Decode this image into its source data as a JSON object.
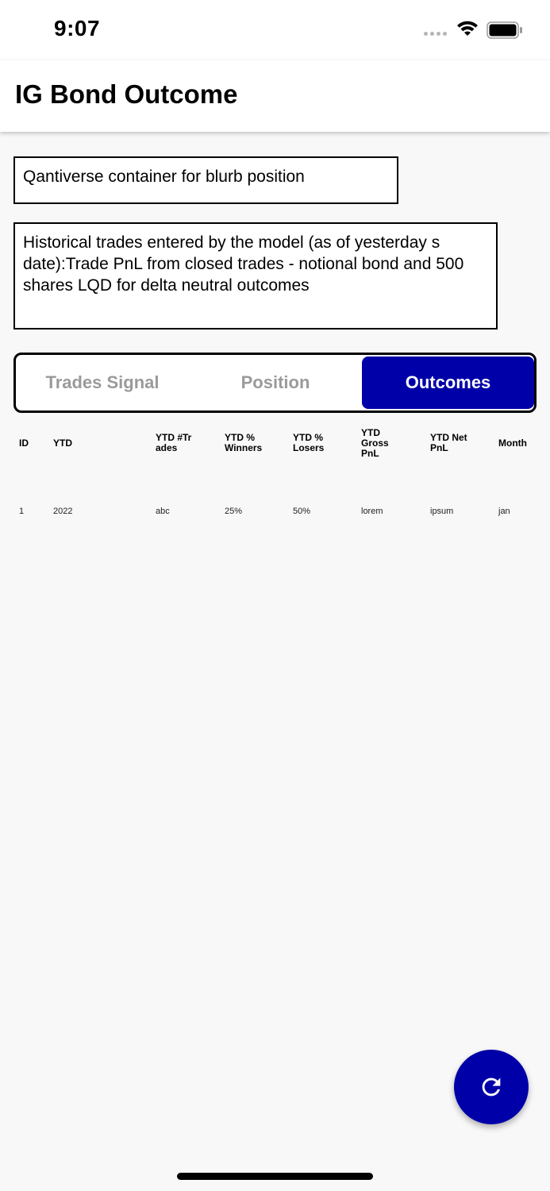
{
  "status_bar": {
    "time": "9:07"
  },
  "app_bar": {
    "title": "IG Bond Outcome"
  },
  "blurb": {
    "text": "Qantiverse container for blurb position"
  },
  "history": {
    "text": "Historical trades entered by the model (as of yesterday s date):Trade PnL from closed trades - notional bond and 500 shares LQD for delta neutral outcomes"
  },
  "tabs": {
    "items": [
      {
        "label": "Trades Signal",
        "selected": false
      },
      {
        "label": "Position",
        "selected": false
      },
      {
        "label": "Outcomes",
        "selected": true
      }
    ]
  },
  "table": {
    "headers": [
      "ID",
      "YTD",
      "YTD #Trades",
      "YTD % Winners",
      "YTD % Losers",
      "YTD Gross PnL",
      "YTD Net PnL",
      "Month"
    ],
    "rows": [
      [
        "1",
        "2022",
        "abc",
        "25%",
        "50%",
        "lorem",
        "ipsum",
        "jan"
      ]
    ]
  },
  "fab": {
    "icon": "refresh-icon"
  },
  "colors": {
    "accent": "#0000a8",
    "background": "#f8f8f8",
    "inactive_tab_text": "#9a9a9a"
  }
}
